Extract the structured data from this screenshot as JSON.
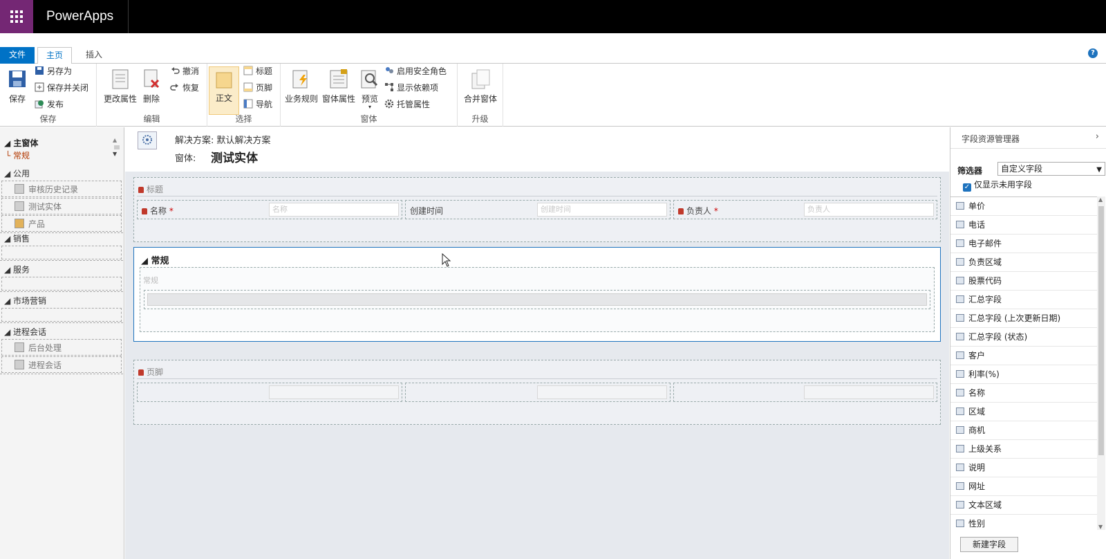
{
  "app": {
    "name": "PowerApps"
  },
  "ribbon": {
    "tabs": {
      "file": "文件",
      "home": "主页",
      "insert": "插入"
    },
    "help": "?",
    "save": {
      "save": "保存",
      "save_as": "另存为",
      "save_close": "保存并关闭",
      "publish": "发布",
      "group": "保存"
    },
    "edit": {
      "change_props": "更改属性",
      "delete": "删除",
      "undo": "撤消",
      "redo": "恢复",
      "group": "编辑"
    },
    "select": {
      "body": "正文",
      "header": "标题",
      "footer": "页脚",
      "nav": "导航",
      "group": "选择"
    },
    "form": {
      "biz_rules": "业务规则",
      "form_props": "窗体属性",
      "preview": "预览",
      "enable_roles": "启用安全角色",
      "show_deps": "显示依赖项",
      "managed_props": "托管属性",
      "group": "窗体"
    },
    "upgrade": {
      "merge": "合并窗体",
      "group": "升级"
    }
  },
  "leftnav": {
    "main": "主窗体",
    "general": "常规",
    "sections": [
      {
        "title": "公用",
        "items": [
          "审核历史记录",
          "测试实体",
          "产品"
        ]
      },
      {
        "title": "销售",
        "items": []
      },
      {
        "title": "服务",
        "items": []
      },
      {
        "title": "市场营销",
        "items": []
      },
      {
        "title": "进程会话",
        "items": [
          "后台处理",
          "进程会话"
        ]
      }
    ]
  },
  "canvas": {
    "solution": "解决方案: 默认解决方案",
    "form_label": "窗体:",
    "form_name": "测试实体",
    "header_section": {
      "title": "标题",
      "fields": [
        {
          "label": "名称",
          "required": "*",
          "placeholder": "名称"
        },
        {
          "label": "创建时间",
          "required": "",
          "placeholder": "创建时间"
        },
        {
          "label": "负责人",
          "required": "*",
          "placeholder": "负责人"
        }
      ]
    },
    "tab": {
      "title": "常规",
      "section_title": "常规"
    },
    "footer_section": {
      "title": "页脚"
    }
  },
  "rpanel": {
    "title": "字段资源管理器",
    "filter_label": "筛选器",
    "filter_value": "自定义字段",
    "only_unused": "仅显示未用字段",
    "fields": [
      "单价",
      "电话",
      "电子邮件",
      "负责区域",
      "股票代码",
      "汇总字段",
      "汇总字段 (上次更新日期)",
      "汇总字段 (状态)",
      "客户",
      "利率(%)",
      "名称",
      "区域",
      "商机",
      "上级关系",
      "说明",
      "网址",
      "文本区域",
      "性别"
    ],
    "new_field": "新建字段"
  }
}
